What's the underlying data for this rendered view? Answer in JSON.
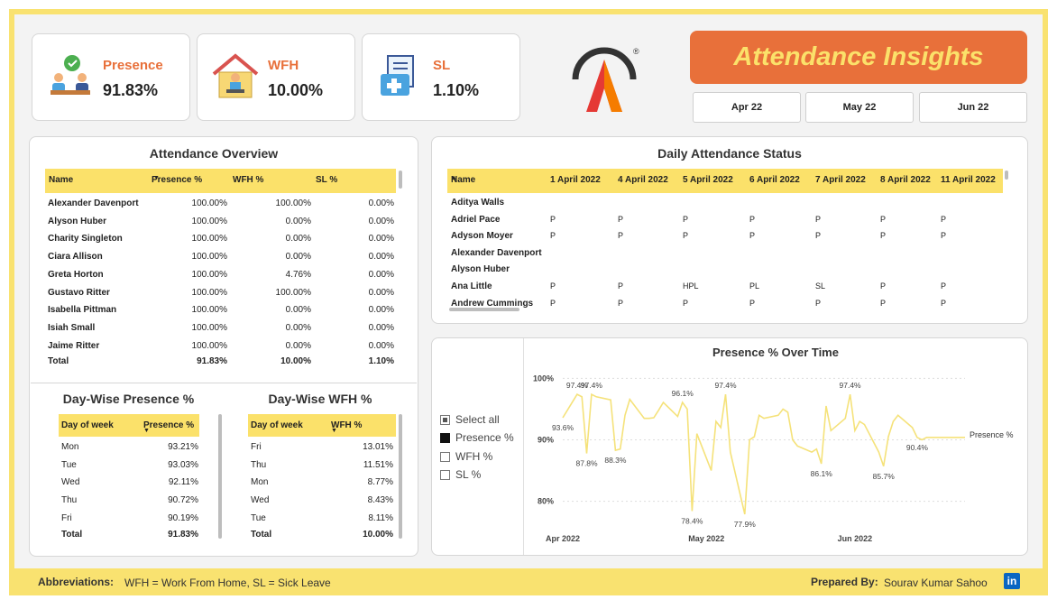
{
  "kpis": [
    {
      "label": "Presence",
      "value": "91.83%",
      "icon": "meeting-people-icon"
    },
    {
      "label": "WFH",
      "value": "10.00%",
      "icon": "home-office-icon"
    },
    {
      "label": "SL",
      "value": "1.10%",
      "icon": "medical-folder-icon"
    }
  ],
  "header": {
    "title": "Attendance Insights",
    "months": [
      "Apr 22",
      "May 22",
      "Jun 22"
    ],
    "logo_mark": "®"
  },
  "overview": {
    "title": "Attendance Overview",
    "columns": [
      "Name",
      "Presence %",
      "WFH %",
      "SL %"
    ],
    "rows": [
      [
        "Alexander Davenport",
        "100.00%",
        "100.00%",
        "0.00%"
      ],
      [
        "Alyson Huber",
        "100.00%",
        "0.00%",
        "0.00%"
      ],
      [
        "Charity Singleton",
        "100.00%",
        "0.00%",
        "0.00%"
      ],
      [
        "Ciara Allison",
        "100.00%",
        "0.00%",
        "0.00%"
      ],
      [
        "Greta Horton",
        "100.00%",
        "4.76%",
        "0.00%"
      ],
      [
        "Gustavo Ritter",
        "100.00%",
        "100.00%",
        "0.00%"
      ],
      [
        "Isabella Pittman",
        "100.00%",
        "0.00%",
        "0.00%"
      ],
      [
        "Isiah Small",
        "100.00%",
        "0.00%",
        "0.00%"
      ],
      [
        "Jaime Ritter",
        "100.00%",
        "0.00%",
        "0.00%"
      ]
    ],
    "total": [
      "Total",
      "91.83%",
      "10.00%",
      "1.10%"
    ]
  },
  "daywise_presence": {
    "title": "Day-Wise Presence %",
    "columns": [
      "Day of week",
      "Presence %"
    ],
    "rows": [
      [
        "Mon",
        "93.21%"
      ],
      [
        "Tue",
        "93.03%"
      ],
      [
        "Wed",
        "92.11%"
      ],
      [
        "Thu",
        "90.72%"
      ],
      [
        "Fri",
        "90.19%"
      ]
    ],
    "total": [
      "Total",
      "91.83%"
    ]
  },
  "daywise_wfh": {
    "title": "Day-Wise WFH %",
    "columns": [
      "Day of week",
      "WFH %"
    ],
    "rows": [
      [
        "Fri",
        "13.01%"
      ],
      [
        "Thu",
        "11.51%"
      ],
      [
        "Mon",
        "8.77%"
      ],
      [
        "Wed",
        "8.43%"
      ],
      [
        "Tue",
        "8.11%"
      ]
    ],
    "total": [
      "Total",
      "10.00%"
    ]
  },
  "daily_status": {
    "title": "Daily Attendance Status",
    "columns": [
      "Name",
      "1 April 2022",
      "4 April 2022",
      "5 April 2022",
      "6 April 2022",
      "7 April 2022",
      "8 April 2022",
      "11 April 2022"
    ],
    "rows": [
      [
        "Aditya Walls",
        "",
        "",
        "",
        "",
        "",
        "",
        ""
      ],
      [
        "Adriel Pace",
        "P",
        "P",
        "P",
        "P",
        "P",
        "P",
        "P"
      ],
      [
        "Adyson Moyer",
        "P",
        "P",
        "P",
        "P",
        "P",
        "P",
        "P"
      ],
      [
        "Alexander Davenport",
        "",
        "",
        "",
        "",
        "",
        "",
        ""
      ],
      [
        "Alyson Huber",
        "",
        "",
        "",
        "",
        "",
        "",
        ""
      ],
      [
        "Ana Little",
        "P",
        "P",
        "HPL",
        "PL",
        "SL",
        "P",
        "P"
      ],
      [
        "Andrew Cummings",
        "P",
        "P",
        "P",
        "P",
        "P",
        "P",
        "P"
      ]
    ]
  },
  "slicer": {
    "items": [
      {
        "label": "Select all",
        "state": "partial"
      },
      {
        "label": "Presence %",
        "state": "on"
      },
      {
        "label": "WFH %",
        "state": "off"
      },
      {
        "label": "SL %",
        "state": "off"
      }
    ]
  },
  "chart_data": {
    "type": "line",
    "title": "Presence % Over Time",
    "series": [
      {
        "name": "Presence %",
        "color": "#f5e27a",
        "x": [
          "2022-04-01",
          "2022-04-04",
          "2022-04-05",
          "2022-04-06",
          "2022-04-07",
          "2022-04-08",
          "2022-04-11",
          "2022-04-12",
          "2022-04-13",
          "2022-04-14",
          "2022-04-15",
          "2022-04-18",
          "2022-04-19",
          "2022-04-20",
          "2022-04-21",
          "2022-04-22",
          "2022-04-25",
          "2022-04-26",
          "2022-04-27",
          "2022-04-28",
          "2022-04-29",
          "2022-05-02",
          "2022-05-03",
          "2022-05-04",
          "2022-05-05",
          "2022-05-06",
          "2022-05-09",
          "2022-05-10",
          "2022-05-11",
          "2022-05-12",
          "2022-05-13",
          "2022-05-16",
          "2022-05-17",
          "2022-05-18",
          "2022-05-19",
          "2022-05-20",
          "2022-05-23",
          "2022-05-24",
          "2022-05-25",
          "2022-05-26",
          "2022-05-27",
          "2022-05-30",
          "2022-05-31",
          "2022-06-01",
          "2022-06-02",
          "2022-06-03",
          "2022-06-06",
          "2022-06-07",
          "2022-06-08",
          "2022-06-09",
          "2022-06-10",
          "2022-06-13",
          "2022-06-14",
          "2022-06-15",
          "2022-06-16",
          "2022-06-17",
          "2022-06-20",
          "2022-06-21",
          "2022-06-22",
          "2022-06-23",
          "2022-06-24"
        ],
        "y": [
          93.6,
          97.4,
          97.0,
          87.8,
          97.4,
          97.0,
          96.5,
          88.3,
          88.5,
          94.0,
          96.6,
          93.5,
          93.5,
          93.6,
          94.8,
          96.1,
          93.8,
          96.1,
          95.0,
          78.4,
          91.0,
          85.0,
          93.0,
          92.0,
          97.4,
          88.0,
          77.9,
          90.0,
          90.5,
          94.0,
          93.5,
          94.0,
          95.0,
          94.5,
          90.0,
          89.0,
          88.0,
          88.5,
          86.1,
          95.5,
          91.5,
          93.5,
          97.4,
          91.5,
          93.0,
          92.5,
          88.0,
          85.7,
          90.5,
          93.0,
          94.0,
          92.0,
          90.4,
          90.0,
          90.4,
          90.4,
          90.4,
          90.4,
          90.4,
          90.4,
          90.4
        ]
      }
    ],
    "data_labels": [
      {
        "x": "2022-04-01",
        "label": "93.6%"
      },
      {
        "x": "2022-04-04",
        "label": "97.4%"
      },
      {
        "x": "2022-04-06",
        "label": "87.8%"
      },
      {
        "x": "2022-04-07",
        "label": "97.4%"
      },
      {
        "x": "2022-04-12",
        "label": "88.3%"
      },
      {
        "x": "2022-04-26",
        "label": "96.1%"
      },
      {
        "x": "2022-04-28",
        "label": "78.4%"
      },
      {
        "x": "2022-05-05",
        "label": "97.4%"
      },
      {
        "x": "2022-05-09",
        "label": "77.9%"
      },
      {
        "x": "2022-05-25",
        "label": "86.1%"
      },
      {
        "x": "2022-05-31",
        "label": "97.4%"
      },
      {
        "x": "2022-06-07",
        "label": "85.7%"
      },
      {
        "x": "2022-06-14",
        "label": "90.4%"
      }
    ],
    "y_ticks": [
      "80%",
      "90%",
      "100%"
    ],
    "x_ticks": [
      "Apr 2022",
      "May 2022",
      "Jun 2022"
    ],
    "ylim": [
      77,
      100.5
    ],
    "grid": true,
    "legend": "right"
  },
  "footer": {
    "abbrev_label": "Abbreviations:",
    "abbrev_text": "WFH = Work From Home, SL = Sick Leave",
    "prepared_label": "Prepared By:",
    "prepared_name": "Sourav Kumar Sahoo",
    "linkedin": "in"
  }
}
